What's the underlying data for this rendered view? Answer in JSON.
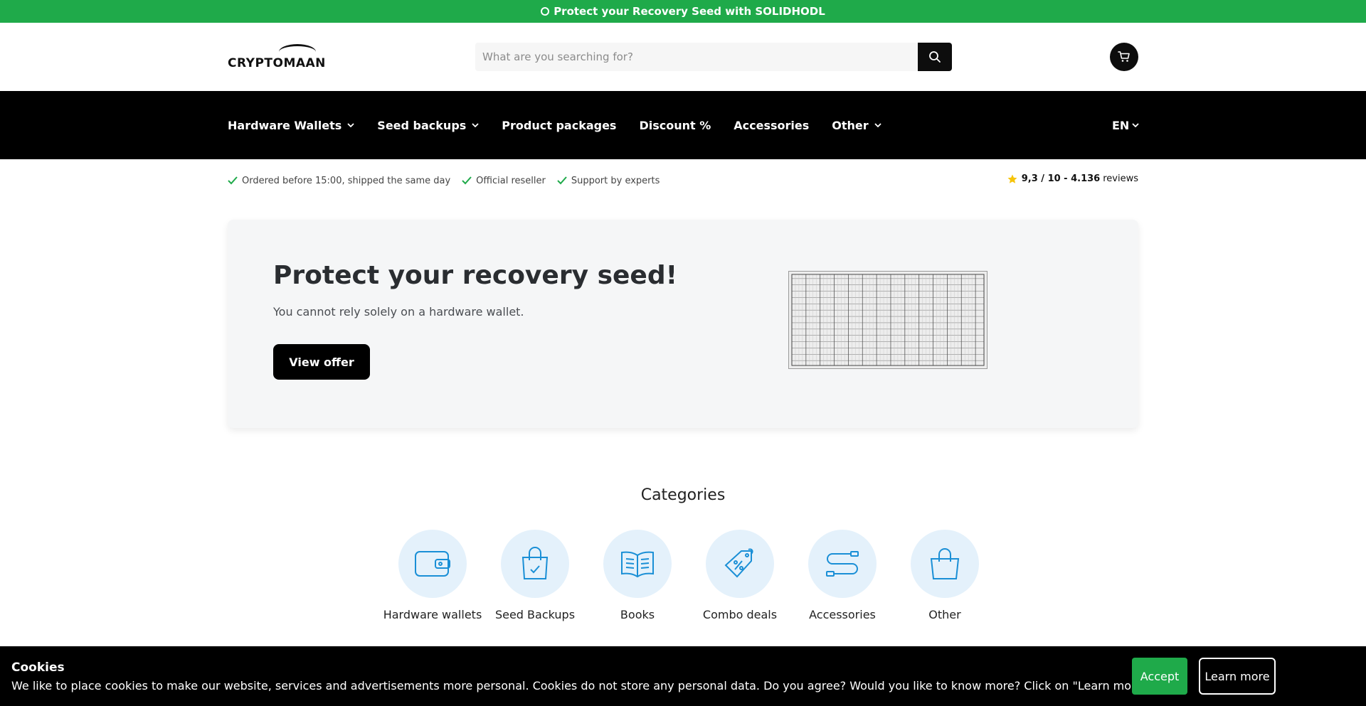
{
  "announcement": {
    "text": "Protect your Recovery Seed with SOLIDHODL",
    "icon": "lock-icon"
  },
  "header": {
    "logo_text": "CRYPTOMAAN",
    "search": {
      "placeholder": "What are you searching for?",
      "value": ""
    },
    "icons": [
      "search-icon",
      "cart-icon"
    ]
  },
  "nav": {
    "items": [
      {
        "label": "Hardware Wallets",
        "dropdown": true
      },
      {
        "label": "Seed backups",
        "dropdown": true
      },
      {
        "label": "Product packages",
        "dropdown": false
      },
      {
        "label": "Discount %",
        "dropdown": false
      },
      {
        "label": "Accessories",
        "dropdown": false
      },
      {
        "label": "Other",
        "dropdown": true
      }
    ],
    "language": "EN"
  },
  "usps": [
    "Ordered before 15:00, shipped the same day",
    "Official reseller",
    "Support by experts"
  ],
  "rating": {
    "score": "9,3 / 10 - 4.136",
    "suffix": "reviews"
  },
  "hero": {
    "title": "Protect your recovery seed!",
    "subtitle": "You cannot rely solely on a hardware wallet.",
    "cta": "View offer"
  },
  "categories": {
    "title": "Categories",
    "items": [
      {
        "label": "Hardware wallets",
        "icon": "wallet-icon"
      },
      {
        "label": "Seed Backups",
        "icon": "shopping-bag-check-icon"
      },
      {
        "label": "Books",
        "icon": "book-icon"
      },
      {
        "label": "Combo deals",
        "icon": "discount-tag-icon"
      },
      {
        "label": "Accessories",
        "icon": "cable-icon"
      },
      {
        "label": "Other",
        "icon": "shopping-bag-icon"
      }
    ]
  },
  "cookie": {
    "title": "Cookies",
    "text": "We like to place cookies to make our website, services and advertisements more personal. Cookies do not store any personal data. Do you agree? Would you like to know more? Click on \"Learn more\".",
    "accept": "Accept",
    "learn_more": "Learn more"
  },
  "colors": {
    "brand_green": "#1faa4a",
    "nav_bg": "#000000",
    "icon_blue": "#1a8fd6",
    "icon_circle": "#e4f1fb",
    "star": "#f6c40a"
  }
}
